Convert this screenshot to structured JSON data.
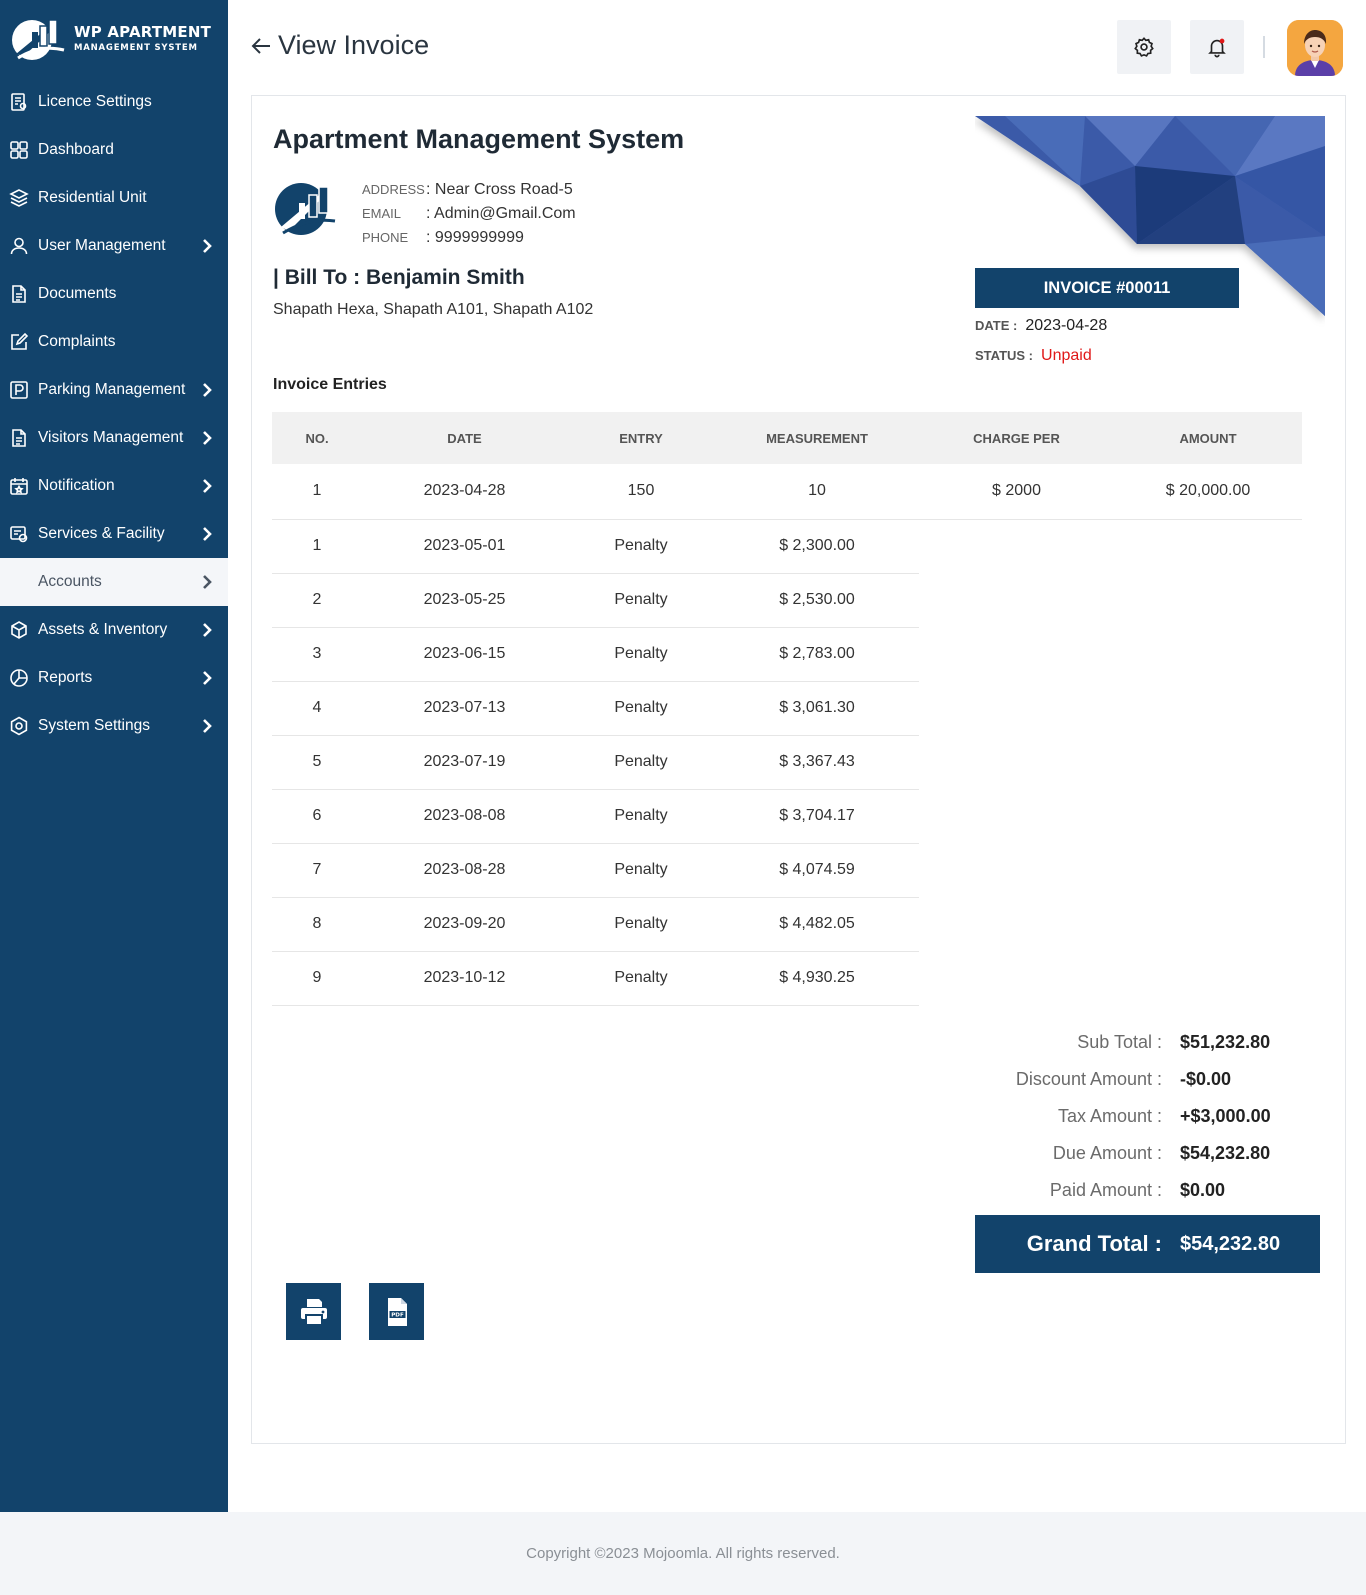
{
  "brand": {
    "title": "WP APARTMENT",
    "subtitle": "MANAGEMENT SYSTEM"
  },
  "sidebar": {
    "items": [
      {
        "label": "Licence Settings",
        "icon": "licence-icon",
        "chevron": false
      },
      {
        "label": "Dashboard",
        "icon": "dashboard-icon",
        "chevron": false
      },
      {
        "label": "Residential Unit",
        "icon": "layers-icon",
        "chevron": false
      },
      {
        "label": "User Management",
        "icon": "user-icon",
        "chevron": true
      },
      {
        "label": "Documents",
        "icon": "document-icon",
        "chevron": false
      },
      {
        "label": "Complaints",
        "icon": "edit-icon",
        "chevron": false
      },
      {
        "label": "Parking Management",
        "icon": "parking-icon",
        "chevron": true
      },
      {
        "label": "Visitors Management",
        "icon": "document-icon",
        "chevron": true
      },
      {
        "label": "Notification",
        "icon": "calendar-icon",
        "chevron": true
      },
      {
        "label": "Services & Facility",
        "icon": "services-icon",
        "chevron": true
      },
      {
        "label": "Accounts",
        "icon": "",
        "chevron": true,
        "active": true
      },
      {
        "label": "Assets & Inventory",
        "icon": "box-icon",
        "chevron": true
      },
      {
        "label": "Reports",
        "icon": "pie-icon",
        "chevron": true
      },
      {
        "label": "System Settings",
        "icon": "settings-icon",
        "chevron": true
      }
    ]
  },
  "header": {
    "title": "View Invoice"
  },
  "invoice": {
    "company": "Apartment Management System",
    "address_label": "ADDRESS",
    "address": "Near Cross Road-5",
    "email_label": "EMAIL",
    "email": "Admin@Gmail.Com",
    "phone_label": "PHONE",
    "phone": "9999999999",
    "bill_to": "| Bill To : Benjamin Smith",
    "bill_address": "Shapath Hexa, Shapath A101, Shapath A102",
    "number": "INVOICE #00011",
    "date_label": "DATE :",
    "date": "2023-04-28",
    "status_label": "STATUS :",
    "status": "Unpaid",
    "status_color": "#e01818",
    "entries_title": "Invoice Entries",
    "columns": [
      "NO.",
      "DATE",
      "ENTRY",
      "MEASUREMENT",
      "CHARGE PER",
      "AMOUNT"
    ],
    "rows": [
      [
        "1",
        "2023-04-28",
        "150",
        "10",
        "$ 2000",
        "$ 20,000.00"
      ],
      [
        "1",
        "2023-05-01",
        "Penalty",
        "$ 2,300.00"
      ],
      [
        "2",
        "2023-05-25",
        "Penalty",
        "$ 2,530.00"
      ],
      [
        "3",
        "2023-06-15",
        "Penalty",
        "$ 2,783.00"
      ],
      [
        "4",
        "2023-07-13",
        "Penalty",
        "$ 3,061.30"
      ],
      [
        "5",
        "2023-07-19",
        "Penalty",
        "$ 3,367.43"
      ],
      [
        "6",
        "2023-08-08",
        "Penalty",
        "$ 3,704.17"
      ],
      [
        "7",
        "2023-08-28",
        "Penalty",
        "$ 4,074.59"
      ],
      [
        "8",
        "2023-09-20",
        "Penalty",
        "$ 4,482.05"
      ],
      [
        "9",
        "2023-10-12",
        "Penalty",
        "$ 4,930.25"
      ]
    ],
    "totals": [
      {
        "label": "Sub Total :",
        "value": "$51,232.80"
      },
      {
        "label": "Discount Amount :",
        "value": "-$0.00"
      },
      {
        "label": "Tax Amount :",
        "value": "+$3,000.00"
      },
      {
        "label": "Due Amount :",
        "value": "$54,232.80"
      },
      {
        "label": "Paid Amount :",
        "value": "$0.00"
      }
    ],
    "grand_total_label": "Grand Total :",
    "grand_total": "$54,232.80"
  },
  "footer": {
    "text": "Copyright ©2023 Mojoomla. All rights reserved."
  },
  "colors": {
    "primary": "#12436b",
    "danger": "#e01818",
    "avatar_bg": "#f4a640"
  }
}
